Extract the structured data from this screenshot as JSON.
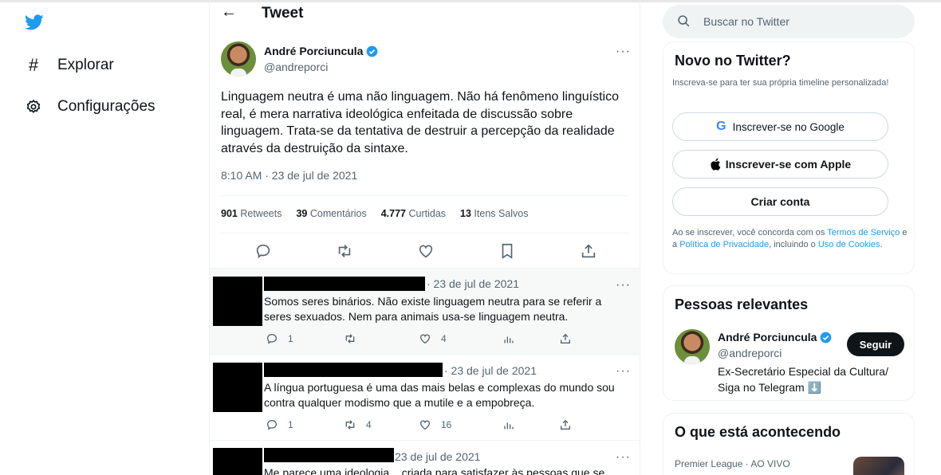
{
  "nav": {
    "items": [
      {
        "label": "Explorar",
        "icon": "hashtag-icon"
      },
      {
        "label": "Configurações",
        "icon": "gear-icon"
      }
    ]
  },
  "header": {
    "title": "Tweet"
  },
  "tweet": {
    "author_name": "André Porciuncula",
    "author_handle": "@andreporci",
    "text": "Linguagem neutra é uma não linguagem. Não há fenômeno linguístico real, é mera narrativa ideológica enfeitada de discussão sobre linguagem. Trata-se da tentativa de destruir a percepção da realidade através da destruição da sintaxe.",
    "time": "8:10 AM · 23 de jul de 2021",
    "stats": [
      {
        "value": "901",
        "label": "Retweets"
      },
      {
        "value": "39",
        "label": "Comentários"
      },
      {
        "value": "4.777",
        "label": "Curtidas"
      },
      {
        "value": "13",
        "label": "Itens Salvos"
      }
    ]
  },
  "replies": [
    {
      "date": "· 23 de jul de 2021",
      "text": "Somos seres binários. Não existe linguagem neutra para se referir a seres sexuados. Nem para animais usa-se linguagem neutra.",
      "replies": "1",
      "retweets": "",
      "likes": "4"
    },
    {
      "date": "· 23 de jul de 2021",
      "text": "A língua portuguesa é uma das mais belas e complexas do mundo sou contra qualquer modismo que a mutile e a empobreça.",
      "replies": "1",
      "retweets": "4",
      "likes": "16"
    },
    {
      "date": "23 de jul de 2021",
      "text": "Me parece uma ideologia... criada para satisfazer às pessoas que se"
    }
  ],
  "search": {
    "placeholder": "Buscar no Twitter"
  },
  "signup": {
    "title": "Novo no Twitter?",
    "subtitle": "Inscreva-se para ter sua própria timeline personalizada!",
    "google": "Inscrever-se no Google",
    "apple": "Inscrever-se com Apple",
    "create": "Criar conta",
    "terms_1": "Ao se inscrever, você concorda com os ",
    "terms_link_1": "Termos de Serviço",
    "terms_2": " e a ",
    "terms_link_2": "Política de Privacidade",
    "terms_3": ", incluindo o ",
    "terms_link_3": "Uso de Cookies",
    "terms_4": "."
  },
  "relevant": {
    "title": "Pessoas relevantes",
    "name": "André Porciuncula",
    "handle": "@andreporci",
    "bio": "Ex-Secretário Especial da Cultura/ Siga no Telegram ⬇️",
    "follow": "Seguir"
  },
  "happening": {
    "title": "O que está acontecendo",
    "meta": "Premier League · AO VIVO"
  },
  "colors": {
    "brand": "#1d9bf0",
    "text": "#0f1419",
    "muted": "#536471"
  }
}
